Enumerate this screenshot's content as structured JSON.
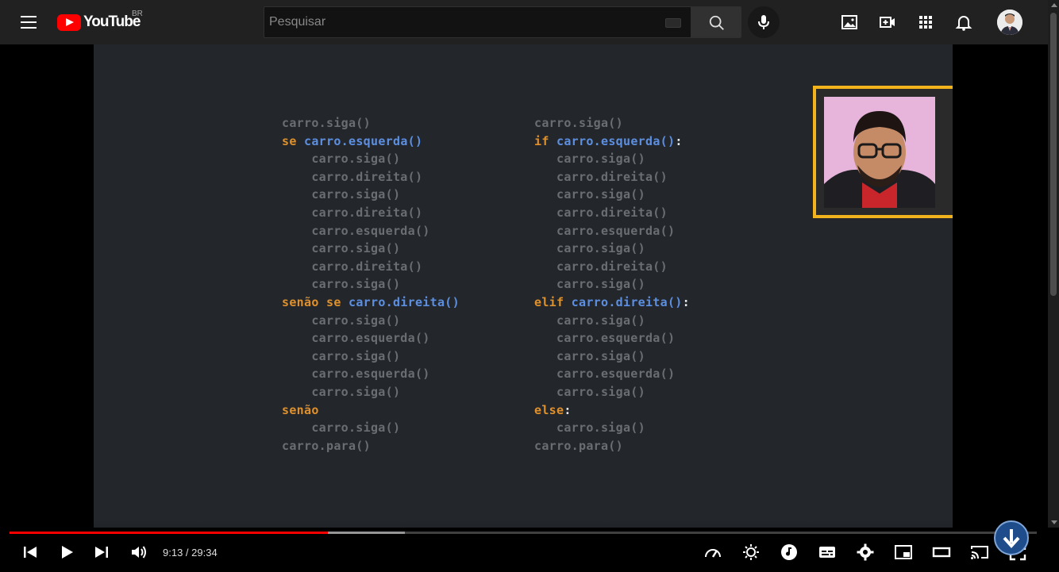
{
  "header": {
    "logo_text": "YouTube",
    "country": "BR",
    "search_placeholder": "Pesquisar",
    "icons": [
      "menu-icon",
      "keyboard-icon",
      "search-icon",
      "mic-icon",
      "image-icon",
      "create-video-icon",
      "apps-icon",
      "notifications-icon"
    ]
  },
  "video": {
    "left_code": [
      {
        "text": "carro.siga()"
      },
      {
        "kw": "se",
        "cond": "carro.esquerda()"
      },
      {
        "text": "    carro.siga()"
      },
      {
        "text": "    carro.direita()"
      },
      {
        "text": "    carro.siga()"
      },
      {
        "text": "    carro.direita()"
      },
      {
        "text": "    carro.esquerda()"
      },
      {
        "text": "    carro.siga()"
      },
      {
        "text": "    carro.direita()"
      },
      {
        "text": "    carro.siga()"
      },
      {
        "kw": "senão se",
        "cond": "carro.direita()"
      },
      {
        "text": "    carro.siga()"
      },
      {
        "text": "    carro.esquerda()"
      },
      {
        "text": "    carro.siga()"
      },
      {
        "text": "    carro.esquerda()"
      },
      {
        "text": "    carro.siga()"
      },
      {
        "kw": "senão"
      },
      {
        "text": "    carro.siga()"
      },
      {
        "text": "carro.para()"
      }
    ],
    "right_code": [
      {
        "text": "carro.siga()"
      },
      {
        "kw": "if",
        "cond": "carro.esquerda()",
        "colon": ":"
      },
      {
        "text": "   carro.siga()"
      },
      {
        "text": "   carro.direita()"
      },
      {
        "text": "   carro.siga()"
      },
      {
        "text": "   carro.direita()"
      },
      {
        "text": "   carro.esquerda()"
      },
      {
        "text": "   carro.siga()"
      },
      {
        "text": "   carro.direita()"
      },
      {
        "text": "   carro.siga()"
      },
      {
        "kw": "elif",
        "cond": "carro.direita()",
        "colon": ":"
      },
      {
        "text": "   carro.siga()"
      },
      {
        "text": "   carro.esquerda()"
      },
      {
        "text": "   carro.siga()"
      },
      {
        "text": "   carro.esquerda()"
      },
      {
        "text": "   carro.siga()"
      },
      {
        "kw": "else",
        "colon": ":"
      },
      {
        "text": "   carro.siga()"
      },
      {
        "text": "carro.para()"
      }
    ],
    "colors": {
      "keyword": "#e0902a",
      "condition": "#5d8fe0",
      "code": "#6a6d72",
      "webcam_border": "#f2b31c"
    }
  },
  "player": {
    "time": "9:13 / 29:34",
    "progress_played": 0.31,
    "progress_loaded": 0.385,
    "controls": [
      "previous-icon",
      "play-icon",
      "next-icon",
      "volume-icon",
      "speed-icon",
      "effects-icon",
      "music-icon",
      "subtitles-icon",
      "settings-icon",
      "miniplayer-icon",
      "theater-icon",
      "cast-icon",
      "fullscreen-icon"
    ]
  }
}
